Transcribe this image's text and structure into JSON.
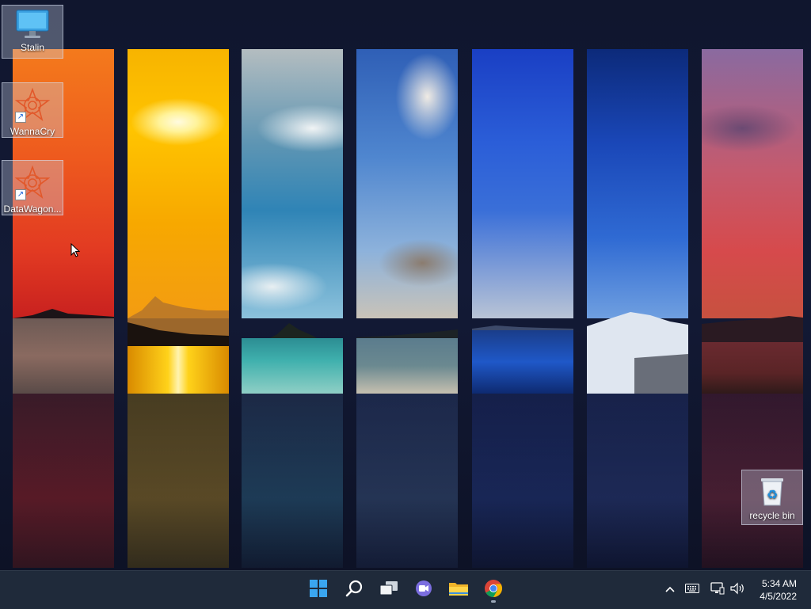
{
  "desktop": {
    "icons": [
      {
        "label": "Stalin",
        "icon": "monitor-icon"
      },
      {
        "label": "WannaCry",
        "icon": "wannacry-icon"
      },
      {
        "label": "DataWagon...",
        "icon": "datawagon-icon"
      },
      {
        "label": "recycle bin",
        "icon": "recycle-bin-icon"
      }
    ]
  },
  "taskbar": {
    "apps": [
      {
        "name": "Start",
        "icon": "windows-start-icon"
      },
      {
        "name": "Search",
        "icon": "search-icon"
      },
      {
        "name": "Task View",
        "icon": "task-view-icon"
      },
      {
        "name": "Chat",
        "icon": "chat-icon"
      },
      {
        "name": "File Explorer",
        "icon": "file-explorer-icon"
      },
      {
        "name": "Chrome",
        "icon": "chrome-icon"
      }
    ],
    "tray": {
      "icons": [
        "chevron-up-icon",
        "keyboard-icon",
        "network-icon",
        "volume-icon"
      ]
    },
    "clock": {
      "time": "5:34 AM",
      "date": "4/5/2022"
    }
  },
  "colors": {
    "taskbar_bg": "#1f2a3a",
    "accent": "#0078d4"
  }
}
